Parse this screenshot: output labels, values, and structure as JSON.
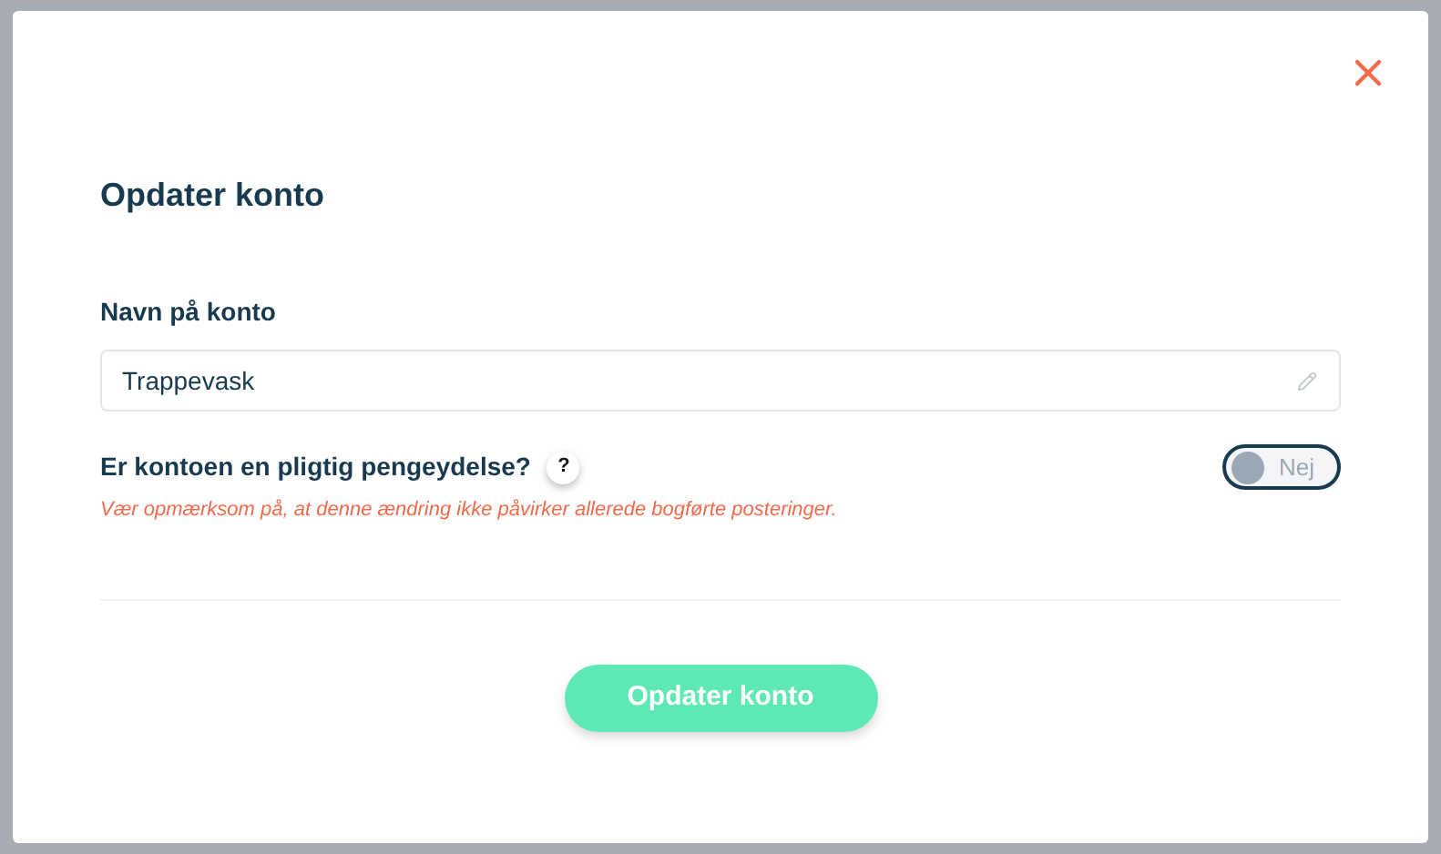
{
  "dialog": {
    "title": "Opdater konto",
    "name_field": {
      "label": "Navn på konto",
      "value": "Trappevask"
    },
    "mandatory": {
      "label": "Er kontoen en pligtig pengeydelse?",
      "help": "?",
      "on": false,
      "toggle_label": "Nej",
      "warning": "Vær opmærksom på, at denne ændring ikke påvirker allerede bogførte posteringer."
    },
    "submit": "Opdater konto"
  }
}
